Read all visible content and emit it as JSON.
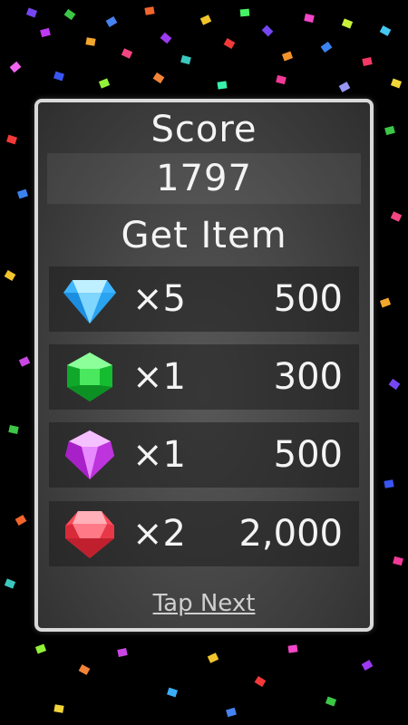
{
  "result_panel": {
    "score_label": "Score",
    "score_value": "1797",
    "get_item_label": "Get Item",
    "items": [
      {
        "gem": "blue-gem-icon",
        "color": "#3fb6ff",
        "quantity": "×5",
        "value": "500"
      },
      {
        "gem": "green-gem-icon",
        "color": "#1fd13a",
        "quantity": "×1",
        "value": "300"
      },
      {
        "gem": "purple-gem-icon",
        "color": "#d54af0",
        "quantity": "×1",
        "value": "500"
      },
      {
        "gem": "red-gem-icon",
        "color": "#ff4a5a",
        "quantity": "×2",
        "value": "2,000"
      }
    ],
    "tap_next": "Tap Next"
  },
  "colors": {
    "background": "#000000",
    "panel_border": "#d9d9d9",
    "text": "#f4f4f4"
  }
}
